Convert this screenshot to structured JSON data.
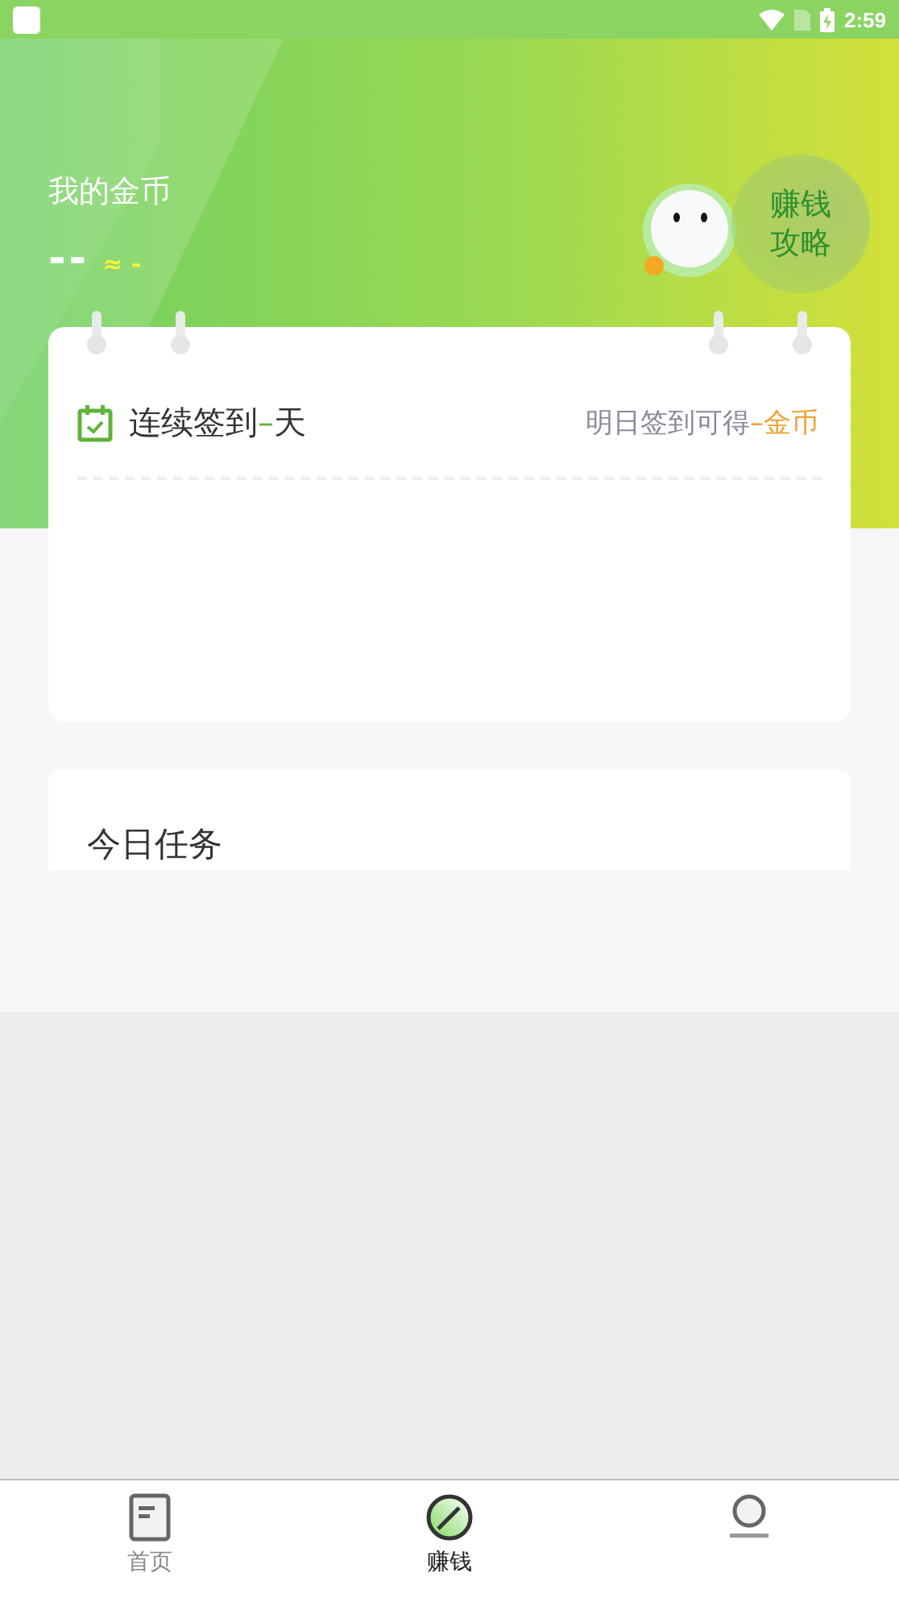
{
  "status_bar": {
    "time": "2:59"
  },
  "header": {
    "title": "我的金币",
    "coins": "--",
    "approx": "≈ -",
    "guide_button": "赚钱攻略"
  },
  "checkin": {
    "prefix": "连续签到",
    "days": "–",
    "suffix": "天",
    "reward_prefix": "明日签到可得",
    "reward": "–金币"
  },
  "tasks": {
    "title": "今日任务"
  },
  "tabs": [
    {
      "label": "首页",
      "selected": false
    },
    {
      "label": "赚钱",
      "selected": true
    },
    {
      "selected": false
    }
  ]
}
